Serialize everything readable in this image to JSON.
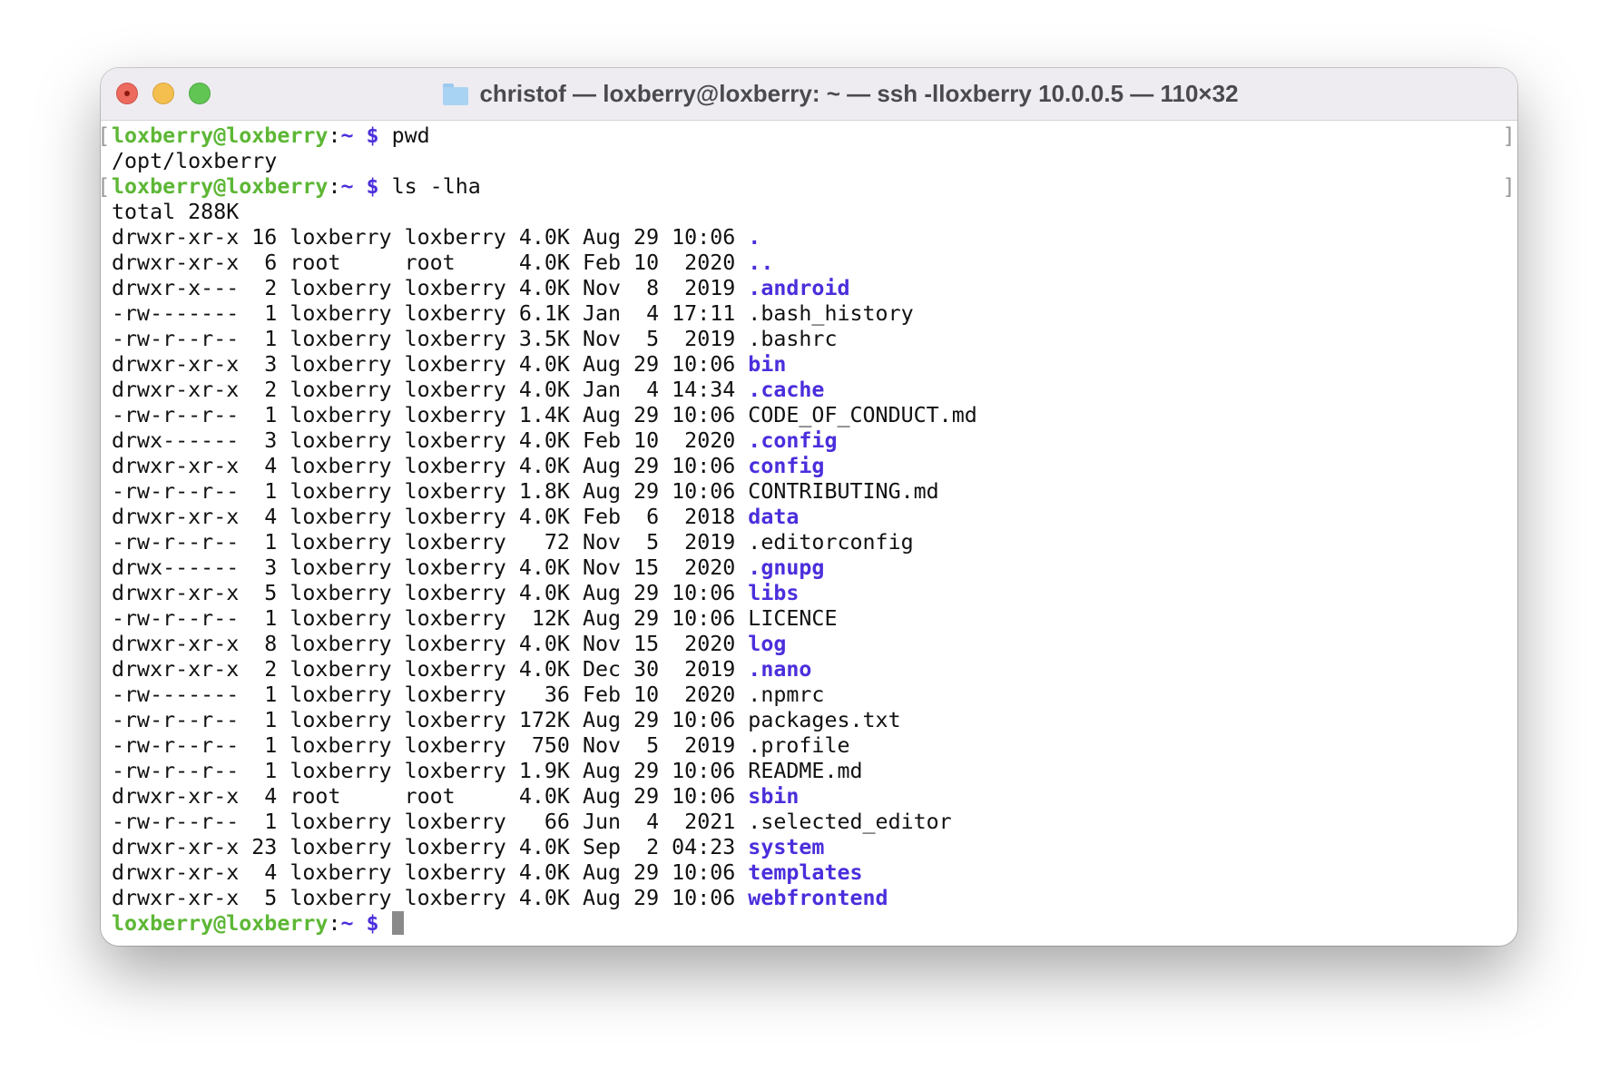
{
  "window": {
    "title": "christof — loxberry@loxberry: ~ — ssh -lloxberry 10.0.0.5 — 110×32",
    "title_icon": "home-folder-icon"
  },
  "prompt": {
    "user_host": "loxberry@loxberry",
    "sep": ":",
    "path": "~",
    "symbol": "$"
  },
  "colors": {
    "prompt": "#5db735",
    "directory": "#4b2edc"
  },
  "session": {
    "cmd1": "pwd",
    "out1": "/opt/loxberry",
    "cmd2": "ls -lha",
    "total": "total 288K"
  },
  "listing": [
    {
      "perm": "drwxr-xr-x",
      "links": "16",
      "owner": "loxberry",
      "group": "loxberry",
      "size": "4.0K",
      "month": "Aug",
      "day": "29",
      "time": "10:06",
      "name": ".",
      "dir": true
    },
    {
      "perm": "drwxr-xr-x",
      "links": "6",
      "owner": "root",
      "group": "root",
      "size": "4.0K",
      "month": "Feb",
      "day": "10",
      "time": "2020",
      "name": "..",
      "dir": true
    },
    {
      "perm": "drwxr-x---",
      "links": "2",
      "owner": "loxberry",
      "group": "loxberry",
      "size": "4.0K",
      "month": "Nov",
      "day": "8",
      "time": "2019",
      "name": ".android",
      "dir": true
    },
    {
      "perm": "-rw-------",
      "links": "1",
      "owner": "loxberry",
      "group": "loxberry",
      "size": "6.1K",
      "month": "Jan",
      "day": "4",
      "time": "17:11",
      "name": ".bash_history",
      "dir": false
    },
    {
      "perm": "-rw-r--r--",
      "links": "1",
      "owner": "loxberry",
      "group": "loxberry",
      "size": "3.5K",
      "month": "Nov",
      "day": "5",
      "time": "2019",
      "name": ".bashrc",
      "dir": false
    },
    {
      "perm": "drwxr-xr-x",
      "links": "3",
      "owner": "loxberry",
      "group": "loxberry",
      "size": "4.0K",
      "month": "Aug",
      "day": "29",
      "time": "10:06",
      "name": "bin",
      "dir": true
    },
    {
      "perm": "drwxr-xr-x",
      "links": "2",
      "owner": "loxberry",
      "group": "loxberry",
      "size": "4.0K",
      "month": "Jan",
      "day": "4",
      "time": "14:34",
      "name": ".cache",
      "dir": true
    },
    {
      "perm": "-rw-r--r--",
      "links": "1",
      "owner": "loxberry",
      "group": "loxberry",
      "size": "1.4K",
      "month": "Aug",
      "day": "29",
      "time": "10:06",
      "name": "CODE_OF_CONDUCT.md",
      "dir": false
    },
    {
      "perm": "drwx------",
      "links": "3",
      "owner": "loxberry",
      "group": "loxberry",
      "size": "4.0K",
      "month": "Feb",
      "day": "10",
      "time": "2020",
      "name": ".config",
      "dir": true
    },
    {
      "perm": "drwxr-xr-x",
      "links": "4",
      "owner": "loxberry",
      "group": "loxberry",
      "size": "4.0K",
      "month": "Aug",
      "day": "29",
      "time": "10:06",
      "name": "config",
      "dir": true
    },
    {
      "perm": "-rw-r--r--",
      "links": "1",
      "owner": "loxberry",
      "group": "loxberry",
      "size": "1.8K",
      "month": "Aug",
      "day": "29",
      "time": "10:06",
      "name": "CONTRIBUTING.md",
      "dir": false
    },
    {
      "perm": "drwxr-xr-x",
      "links": "4",
      "owner": "loxberry",
      "group": "loxberry",
      "size": "4.0K",
      "month": "Feb",
      "day": "6",
      "time": "2018",
      "name": "data",
      "dir": true
    },
    {
      "perm": "-rw-r--r--",
      "links": "1",
      "owner": "loxberry",
      "group": "loxberry",
      "size": "72",
      "month": "Nov",
      "day": "5",
      "time": "2019",
      "name": ".editorconfig",
      "dir": false
    },
    {
      "perm": "drwx------",
      "links": "3",
      "owner": "loxberry",
      "group": "loxberry",
      "size": "4.0K",
      "month": "Nov",
      "day": "15",
      "time": "2020",
      "name": ".gnupg",
      "dir": true
    },
    {
      "perm": "drwxr-xr-x",
      "links": "5",
      "owner": "loxberry",
      "group": "loxberry",
      "size": "4.0K",
      "month": "Aug",
      "day": "29",
      "time": "10:06",
      "name": "libs",
      "dir": true
    },
    {
      "perm": "-rw-r--r--",
      "links": "1",
      "owner": "loxberry",
      "group": "loxberry",
      "size": "12K",
      "month": "Aug",
      "day": "29",
      "time": "10:06",
      "name": "LICENCE",
      "dir": false
    },
    {
      "perm": "drwxr-xr-x",
      "links": "8",
      "owner": "loxberry",
      "group": "loxberry",
      "size": "4.0K",
      "month": "Nov",
      "day": "15",
      "time": "2020",
      "name": "log",
      "dir": true
    },
    {
      "perm": "drwxr-xr-x",
      "links": "2",
      "owner": "loxberry",
      "group": "loxberry",
      "size": "4.0K",
      "month": "Dec",
      "day": "30",
      "time": "2019",
      "name": ".nano",
      "dir": true
    },
    {
      "perm": "-rw-------",
      "links": "1",
      "owner": "loxberry",
      "group": "loxberry",
      "size": "36",
      "month": "Feb",
      "day": "10",
      "time": "2020",
      "name": ".npmrc",
      "dir": false
    },
    {
      "perm": "-rw-r--r--",
      "links": "1",
      "owner": "loxberry",
      "group": "loxberry",
      "size": "172K",
      "month": "Aug",
      "day": "29",
      "time": "10:06",
      "name": "packages.txt",
      "dir": false
    },
    {
      "perm": "-rw-r--r--",
      "links": "1",
      "owner": "loxberry",
      "group": "loxberry",
      "size": "750",
      "month": "Nov",
      "day": "5",
      "time": "2019",
      "name": ".profile",
      "dir": false
    },
    {
      "perm": "-rw-r--r--",
      "links": "1",
      "owner": "loxberry",
      "group": "loxberry",
      "size": "1.9K",
      "month": "Aug",
      "day": "29",
      "time": "10:06",
      "name": "README.md",
      "dir": false
    },
    {
      "perm": "drwxr-xr-x",
      "links": "4",
      "owner": "root",
      "group": "root",
      "size": "4.0K",
      "month": "Aug",
      "day": "29",
      "time": "10:06",
      "name": "sbin",
      "dir": true
    },
    {
      "perm": "-rw-r--r--",
      "links": "1",
      "owner": "loxberry",
      "group": "loxberry",
      "size": "66",
      "month": "Jun",
      "day": "4",
      "time": "2021",
      "name": ".selected_editor",
      "dir": false
    },
    {
      "perm": "drwxr-xr-x",
      "links": "23",
      "owner": "loxberry",
      "group": "loxberry",
      "size": "4.0K",
      "month": "Sep",
      "day": "2",
      "time": "04:23",
      "name": "system",
      "dir": true
    },
    {
      "perm": "drwxr-xr-x",
      "links": "4",
      "owner": "loxberry",
      "group": "loxberry",
      "size": "4.0K",
      "month": "Aug",
      "day": "29",
      "time": "10:06",
      "name": "templates",
      "dir": true
    },
    {
      "perm": "drwxr-xr-x",
      "links": "5",
      "owner": "loxberry",
      "group": "loxberry",
      "size": "4.0K",
      "month": "Aug",
      "day": "29",
      "time": "10:06",
      "name": "webfrontend",
      "dir": true
    }
  ]
}
